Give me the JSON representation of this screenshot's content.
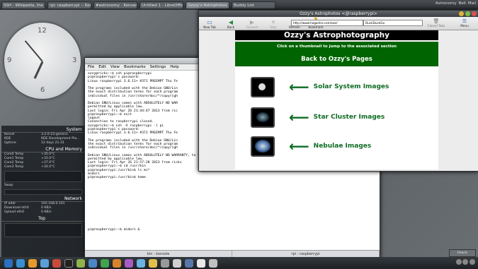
{
  "taskbar": {
    "tabs": [
      "SSH - Wikipedia, the free...",
      "rpi: raspberrypi -- Konsole",
      "#astronomy - Konversat...",
      "Untitled 1 - LibreOffice W...",
      "Ozzzy's Astrophotos",
      "Buddy List"
    ],
    "right": [
      "Astronomy",
      "Bell",
      "Mail"
    ]
  },
  "sysmon": {
    "system_header": "System",
    "system_rows": [
      [
        "Kernel",
        "3.2.0-23-generic"
      ],
      [
        "KDE",
        "KDE Development Pla..."
      ],
      [
        "Uptime",
        "12 days 21:31"
      ]
    ],
    "cpu_header": "CPU and Memory",
    "cpu_rows": [
      [
        "Core0 Temp",
        "+35.0°C"
      ],
      [
        "Core1 Temp",
        "+33.0°C"
      ],
      [
        "Core2 Temp",
        "+37.0°C"
      ],
      [
        "Core3 Temp",
        "+34.0°C"
      ]
    ],
    "swap_label": "Swap",
    "network_header": "Network",
    "network_rows": [
      [
        "IP addr",
        "192.168.0.101"
      ],
      [
        "Download eth0",
        "0 KB/s"
      ],
      [
        "Upload eth0",
        "0 KB/s"
      ]
    ],
    "top_header": "Top"
  },
  "terminal": {
    "menu": [
      "File",
      "Edit",
      "View",
      "Bookmarks",
      "Settings",
      "Help"
    ],
    "lines": [
      "ozzy@ricks:~$ ssh pi@raspberrypi",
      "pi@raspberrypi's password:",
      "Linux raspberrypi 3.6.11+ #371 PREEMPT Thu Fe",
      "",
      "The programs included with the Debian GNU/Lin",
      "the exact distribution terms for each program",
      "individual files in /usr/share/doc/*/copyrigh",
      "",
      "Debian GNU/Linux comes with ABSOLUTELY NO WAR",
      "permitted by applicable law.",
      "Last login: Fri Apr 26 21:44:47 2013 from ric",
      "pi@raspberrypi:~$ exit",
      "logout",
      "Connection to raspberrypi closed.",
      "ozzy@ricks:~$ ssh -X raspberrypi -l pi",
      "pi@raspberrypi's password:",
      "Linux raspberrypi 3.6.11+ #371 PREEMPT Thu Fe",
      "",
      "The programs included with the Debian GNU/Lin",
      "the exact distribution terms for each program",
      "individual files in /usr/share/doc/*/copyrigh",
      "",
      "Debian GNU/Linux comes with ABSOLUTELY NO WARRANTY, to the extent",
      "permitted by applicable law.",
      "Last login: Fri Apr 26 21:57:28 2013 from ricks",
      "pi@raspberrypi:~$ cd /usr/bin",
      "pi@raspberrypi:/usr/bin$ ls mi*",
      "midori",
      "pi@raspberrypi:/usr/bin$ home",
      "",
      "",
      "",
      "",
      "",
      "",
      "",
      "",
      "",
      "",
      "",
      "",
      "",
      "pi@raspberrypi:~$ midori &"
    ],
    "status_left": "bin : konsole",
    "status_right": "rpi : raspberrypi"
  },
  "browser": {
    "title": "Ozzy's Astrophotos <@raspberrypi>",
    "toolbar": [
      "New Tab",
      "Back",
      "Forward",
      "Stop",
      "Refresh",
      "Add Bookmark"
    ],
    "url": "http://www.hogastro.com/ozz/",
    "search": "DuckDuckGo",
    "right_buttons": [
      "Closed Tabs",
      "Menu"
    ],
    "page": {
      "title": "Ozzy's Astrophotography",
      "tagline": "Click on a thumbnail to jump to the associated section",
      "back_link": "Back to Ozzy's Pages",
      "sections": [
        {
          "label": "Solar System Images",
          "arrow": "⟵"
        },
        {
          "label": "Star Cluster Images",
          "arrow": "⟵"
        },
        {
          "label": "Nebulae Images",
          "arrow": "⟵"
        }
      ]
    }
  },
  "colors": {
    "page_green": "#006400",
    "text_green": "#0f6b23"
  },
  "mini_window": "Imaris"
}
